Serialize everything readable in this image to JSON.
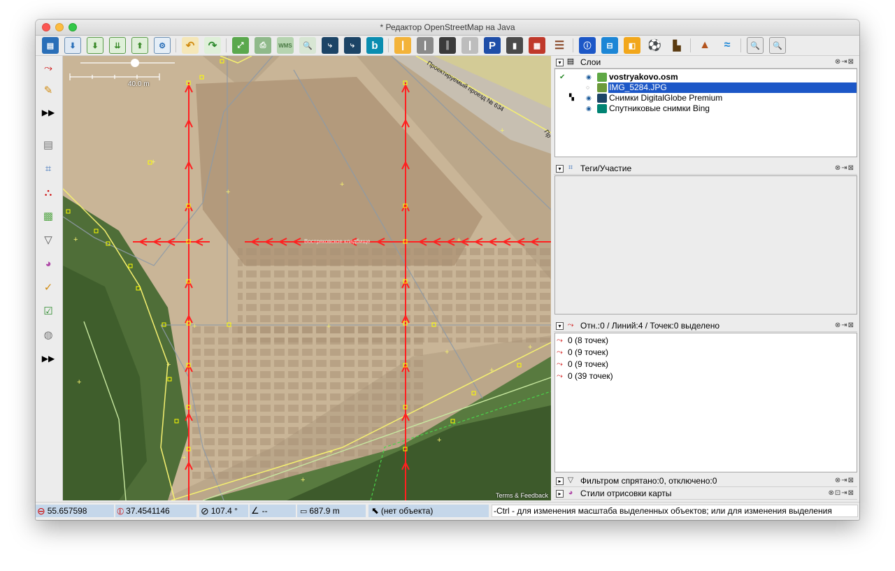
{
  "window": {
    "title": "* Редактор OpenStreetMap на Java"
  },
  "toolbar": {
    "buttons": [
      "open-icon",
      "download-icon",
      "download-object-icon",
      "download-new-icon",
      "upload-icon",
      "preferences-icon",
      "undo-icon",
      "redo-icon",
      "zoom-to-selection-icon",
      "print-icon",
      "wms-icon",
      "search-icon",
      "imagery-icon",
      "imagery2-icon",
      "bing-icon",
      "road-icon",
      "track-icon",
      "railway-icon",
      "footway-icon",
      "parking-icon",
      "traffic-light-icon",
      "wall-icon",
      "rail-icon",
      "info-icon",
      "hotel-icon",
      "shop-icon",
      "sport-icon",
      "industrial-icon",
      "peak-icon",
      "river-icon",
      "zoom-in-icon",
      "zoom-out-icon"
    ]
  },
  "left_toolbar": {
    "icons": [
      "select-icon",
      "draw-icon",
      "more-icon",
      "layers-icon",
      "tags-icon",
      "relation-icon",
      "image-icon",
      "filter-icon",
      "style-icon",
      "validator-icon",
      "checklist-icon",
      "wiki-icon",
      "more2-icon"
    ]
  },
  "map": {
    "scale_label": "40.0 m",
    "attribution": "Terms & Feedback",
    "street_label": "Проектируемый проезд № 634",
    "street_label2": "Пр",
    "way_label": "Востряковское кладбище"
  },
  "layers_panel": {
    "title": "Слои",
    "layers": [
      {
        "name": "vostryakovo.osm",
        "bold": true,
        "active": true,
        "selected": false,
        "color": "#5fa845"
      },
      {
        "name": "IMG_5284.JPG",
        "bold": false,
        "active": false,
        "selected": true,
        "color": "#6c9a3b"
      },
      {
        "name": "Снимки DigitalGlobe Premium",
        "bold": false,
        "active": false,
        "selected": false,
        "color": "#1c4466"
      },
      {
        "name": "Спутниковые снимки Bing",
        "bold": false,
        "active": false,
        "selected": false,
        "color": "#008373"
      }
    ]
  },
  "tags_panel": {
    "title": "Теги/Участие"
  },
  "selection_panel": {
    "title": "Отн.:0 / Линий:4 / Точек:0 выделено",
    "items": [
      "0 (8 точек)",
      "0 (9 точек)",
      "0 (9 точек)",
      "0 (39 точек)"
    ]
  },
  "filter_panel": {
    "title": "Фильтром спрятано:0, отключено:0"
  },
  "style_panel": {
    "title": "Стили отрисовки карты"
  },
  "status": {
    "lat": "55.657598",
    "lon": "37.4541146",
    "heading": "107.4 °",
    "angle": "--",
    "distance": "687.9 m",
    "object": "(нет объекта)",
    "help": "-Ctrl - для изменения масштаба выделенных объектов; или для изменения выделения"
  },
  "colors": {
    "accent": "#1c57c7",
    "way": "#ff0000",
    "road": "#ffff66"
  }
}
